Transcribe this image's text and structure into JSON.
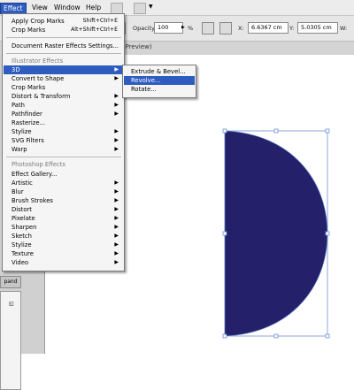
{
  "menubar": {
    "items": [
      "Effect",
      "View",
      "Window",
      "Help"
    ],
    "active": "Effect"
  },
  "control_bar": {
    "opacity_label": "Opacity:",
    "opacity_value": "100",
    "opacity_unit": "%",
    "x_label": "X:",
    "x_value": "6.6367 cm",
    "y_label": "Y:",
    "y_value": "5.0305 cm",
    "w_label": "W:"
  },
  "document_tab": {
    "title_fragment": "% (Preview)"
  },
  "effect_menu": {
    "apply_crop_marks": {
      "label": "Apply Crop Marks",
      "shortcut": "Shift+Ctrl+E"
    },
    "crop_marks": {
      "label": "Crop Marks",
      "shortcut": "Alt+Shift+Ctrl+E"
    },
    "document_raster": {
      "label": "Document Raster Effects Settings..."
    },
    "illustrator_effects_header": "Illustrator Effects",
    "illustrator_effects": [
      "3D",
      "Convert to Shape",
      "Crop Marks",
      "Distort & Transform",
      "Path",
      "Pathfinder",
      "Rasterize...",
      "Stylize",
      "SVG Filters",
      "Warp"
    ],
    "photoshop_effects_header": "Photoshop Effects",
    "photoshop_effects": [
      "Effect Gallery...",
      "Artistic",
      "Blur",
      "Brush Strokes",
      "Distort",
      "Pixelate",
      "Sharpen",
      "Sketch",
      "Stylize",
      "Texture",
      "Video"
    ],
    "highlighted": "3D"
  },
  "submenu_3d": {
    "items": [
      "Extrude & Bevel...",
      "Revolve...",
      "Rotate..."
    ],
    "highlighted": "Revolve..."
  },
  "left_panel": {
    "expand_label": "pand"
  },
  "colors": {
    "menu_highlight": "#2f5dbf",
    "shape_fill": "#24216a",
    "selection_stroke": "#6b8fd6"
  }
}
